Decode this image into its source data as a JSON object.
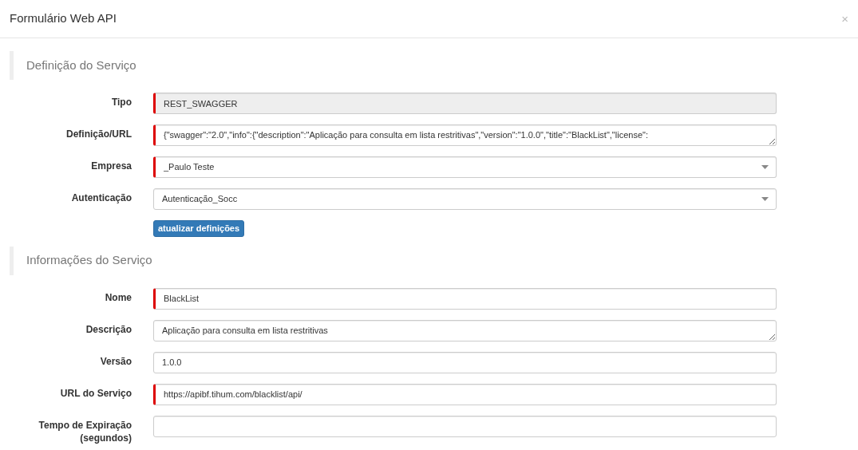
{
  "window": {
    "title": "Formulário Web API",
    "close": "×"
  },
  "sections": [
    {
      "title": "Definição do Serviço",
      "fields": [
        {
          "label": "Tipo",
          "kind": "input",
          "value": "REST_SWAGGER",
          "required": true,
          "disabled": true
        },
        {
          "label": "Definição/URL",
          "kind": "textarea",
          "value": "{\"swagger\":\"2.0\",\"info\":{\"description\":\"Aplicação para consulta em lista restritivas\",\"version\":\"1.0.0\",\"title\":\"BlackList\",\"license\":",
          "required": true,
          "disabled": false
        },
        {
          "label": "Empresa",
          "kind": "select",
          "value": "_Paulo Teste",
          "required": true,
          "disabled": false
        },
        {
          "label": "Autenticação",
          "kind": "select",
          "value": "Autenticação_Socc",
          "required": false,
          "disabled": false
        }
      ],
      "button": "atualizar definições"
    },
    {
      "title": "Informações do Serviço",
      "fields": [
        {
          "label": "Nome",
          "kind": "input",
          "value": "BlackList",
          "required": true,
          "disabled": false
        },
        {
          "label": "Descrição",
          "kind": "textarea",
          "value": "Aplicação para consulta em lista restritivas",
          "required": false,
          "disabled": false
        },
        {
          "label": "Versão",
          "kind": "input",
          "value": "1.0.0",
          "required": false,
          "disabled": false
        },
        {
          "label": "URL do Serviço",
          "kind": "input",
          "value": "https://apibf.tihum.com/blacklist/api/",
          "required": true,
          "disabled": false
        },
        {
          "label": "Tempo de Expiração (segundos)",
          "kind": "input",
          "required": false,
          "disabled": false
        }
      ]
    }
  ]
}
